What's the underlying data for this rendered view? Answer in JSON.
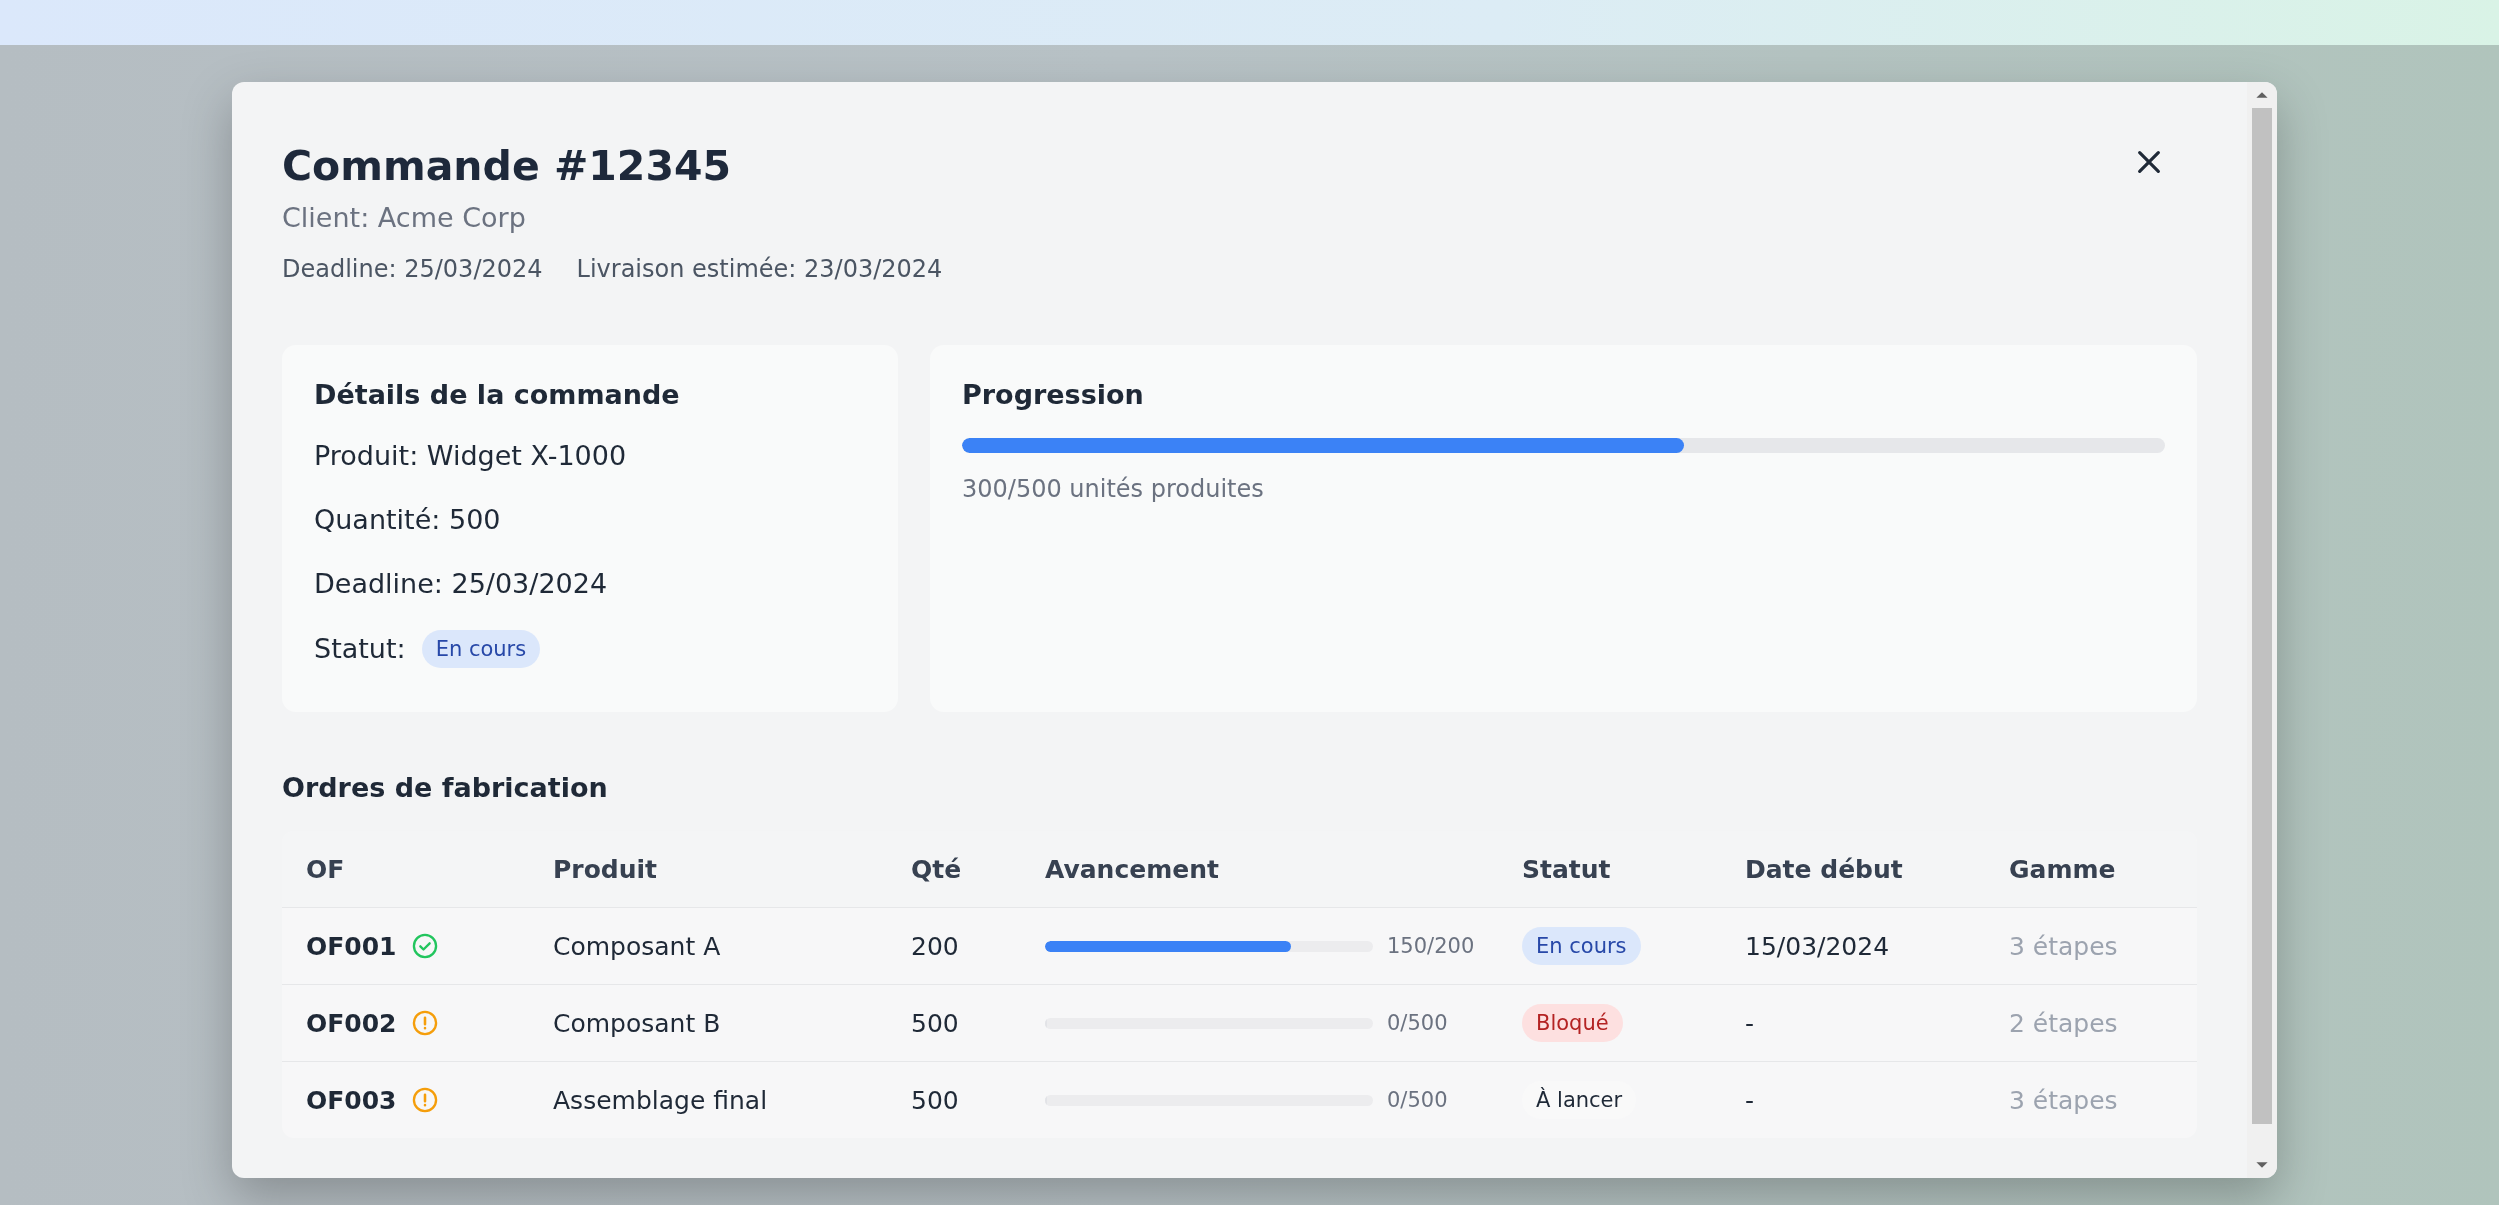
{
  "modal": {
    "title": "Commande #12345",
    "client": "Client: Acme Corp",
    "deadline": "Deadline: 25/03/2024",
    "estimated_delivery": "Livraison estimée: 23/03/2024"
  },
  "details": {
    "title": "Détails de la commande",
    "lines": [
      "Produit: Widget X-1000",
      "Quantité: 500",
      "Deadline: 25/03/2024"
    ],
    "status_label": "Statut:",
    "status": {
      "text": "En cours",
      "kind": "in_progress"
    }
  },
  "progress": {
    "title": "Progression",
    "level": 0.6,
    "caption": "300/500 unités produites"
  },
  "orders": {
    "title": "Ordres de fabrication",
    "columns": [
      "OF",
      "Produit",
      "Qté",
      "Avancement",
      "Statut",
      "Date début",
      "Gamme"
    ],
    "rows": [
      {
        "of": "OF001",
        "kind": "done",
        "product": "Composant A",
        "qty": "200",
        "level": 0.75,
        "reading": "150/200",
        "status": {
          "text": "En cours",
          "kind": "in_progress"
        },
        "start": "15/03/2024",
        "route": "3 étapes"
      },
      {
        "of": "OF002",
        "kind": "alert",
        "product": "Composant B",
        "qty": "500",
        "level": 0,
        "reading": "0/500",
        "status": {
          "text": "Bloqué",
          "kind": "blocked"
        },
        "start": "-",
        "route": "2 étapes"
      },
      {
        "of": "OF003",
        "kind": "alert",
        "product": "Assemblage final",
        "qty": "500",
        "level": 0,
        "reading": "0/500",
        "status": {
          "text": "À lancer",
          "kind": "to_start"
        },
        "start": "-",
        "route": "3 étapes"
      }
    ]
  }
}
